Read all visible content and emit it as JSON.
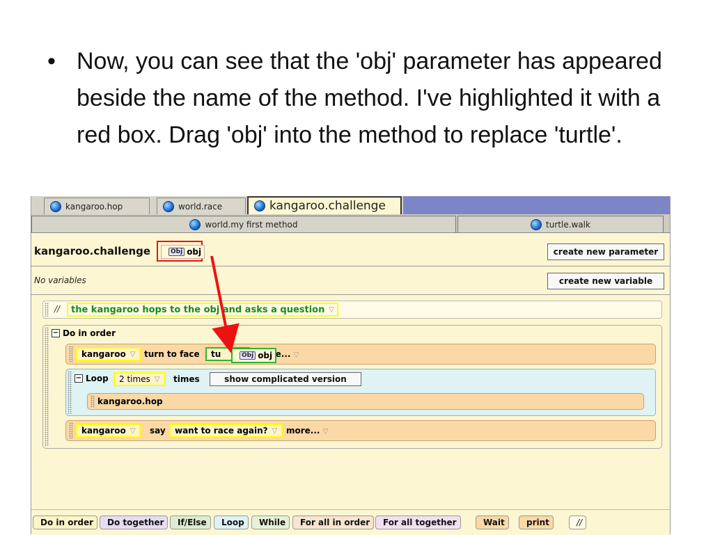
{
  "slide": {
    "bullet": "•",
    "text": "Now, you can see that the 'obj' parameter has appeared beside the name of the method. I've highlighted it with a red box. Drag 'obj' into the method to replace 'turtle'."
  },
  "tabs": {
    "kangaroo_hop": "kangaroo.hop",
    "world_race": "world.race",
    "kangaroo_challenge": "kangaroo.challenge"
  },
  "subtabs": {
    "world_first": "world.my first method",
    "turtle_walk": "turtle.walk"
  },
  "method": {
    "name": "kangaroo.challenge",
    "param_icon": "Obj",
    "param_name": "obj",
    "create_param": "create new parameter",
    "no_vars": "No variables",
    "create_var": "create new variable"
  },
  "code": {
    "comment_slashes": "//",
    "comment": "the kangaroo hops to the obj and asks a question",
    "do_in_order": "Do in order",
    "s1_obj": "kangaroo",
    "s1_action": "turn to face",
    "s1_arg_partial": "tu",
    "s1_more": "more...",
    "drag_icon": "Obj",
    "drag_name": "obj",
    "loop_label": "Loop",
    "loop_count": "2 times",
    "loop_times": "times",
    "loop_btn": "show complicated version",
    "loop_body": "kangaroo.hop",
    "s3_obj": "kangaroo",
    "s3_action": "say",
    "s3_text": "want to race again?",
    "s3_more": "more...",
    "dropdown_glyph": "▽"
  },
  "palette": {
    "do_in_order": "Do in order",
    "do_together": "Do together",
    "if_else": "If/Else",
    "loop": "Loop",
    "while": "While",
    "for_all_in_order": "For all in order",
    "for_all_together": "For all together",
    "wait": "Wait",
    "print": "print",
    "comment": "//"
  },
  "colors": {
    "highlight_box": "#ee1111",
    "arrow": "#ee1111",
    "tab_fill": "#7c86c6"
  }
}
